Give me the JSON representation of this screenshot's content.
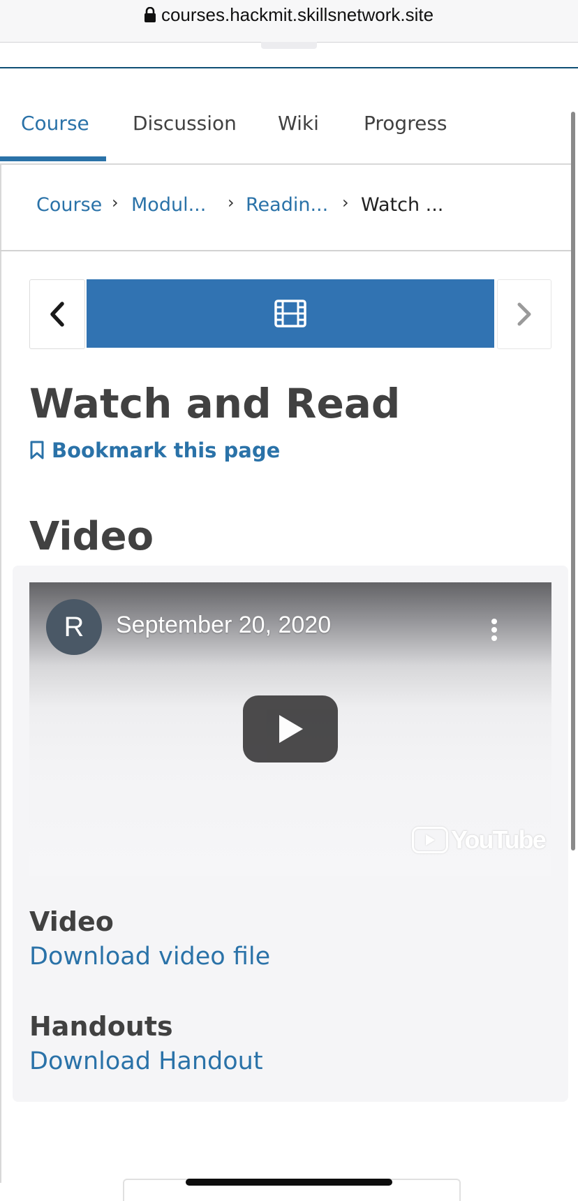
{
  "browser": {
    "url": "courses.hackmit.skillsnetwork.site"
  },
  "tabs": [
    {
      "label": "Course",
      "active": true
    },
    {
      "label": "Discussion",
      "active": false
    },
    {
      "label": "Wiki",
      "active": false
    },
    {
      "label": "Progress",
      "active": false
    }
  ],
  "breadcrumbs": [
    {
      "label": "Course"
    },
    {
      "label": "Modul..."
    },
    {
      "label": "Readin..."
    },
    {
      "label": "Watch ..."
    }
  ],
  "unit": {
    "title": "Watch and Read",
    "bookmark_label": "Bookmark this page",
    "section_title": "Video"
  },
  "video": {
    "channel_initial": "R",
    "title": "September 20, 2020",
    "brand": "YouTube"
  },
  "downloads": {
    "video_heading": "Video",
    "video_link": "Download video file",
    "handouts_heading": "Handouts",
    "handout_link": "Download Handout"
  },
  "colors": {
    "accent": "#2a72a8",
    "active_unit": "#3173b2",
    "heading": "#414141"
  },
  "icons": {
    "lock": "lock-icon",
    "prev": "chevron-left-icon",
    "next": "chevron-right-icon",
    "unit": "film-icon",
    "bookmark": "bookmark-icon",
    "play": "play-icon",
    "more": "more-vertical-icon"
  }
}
